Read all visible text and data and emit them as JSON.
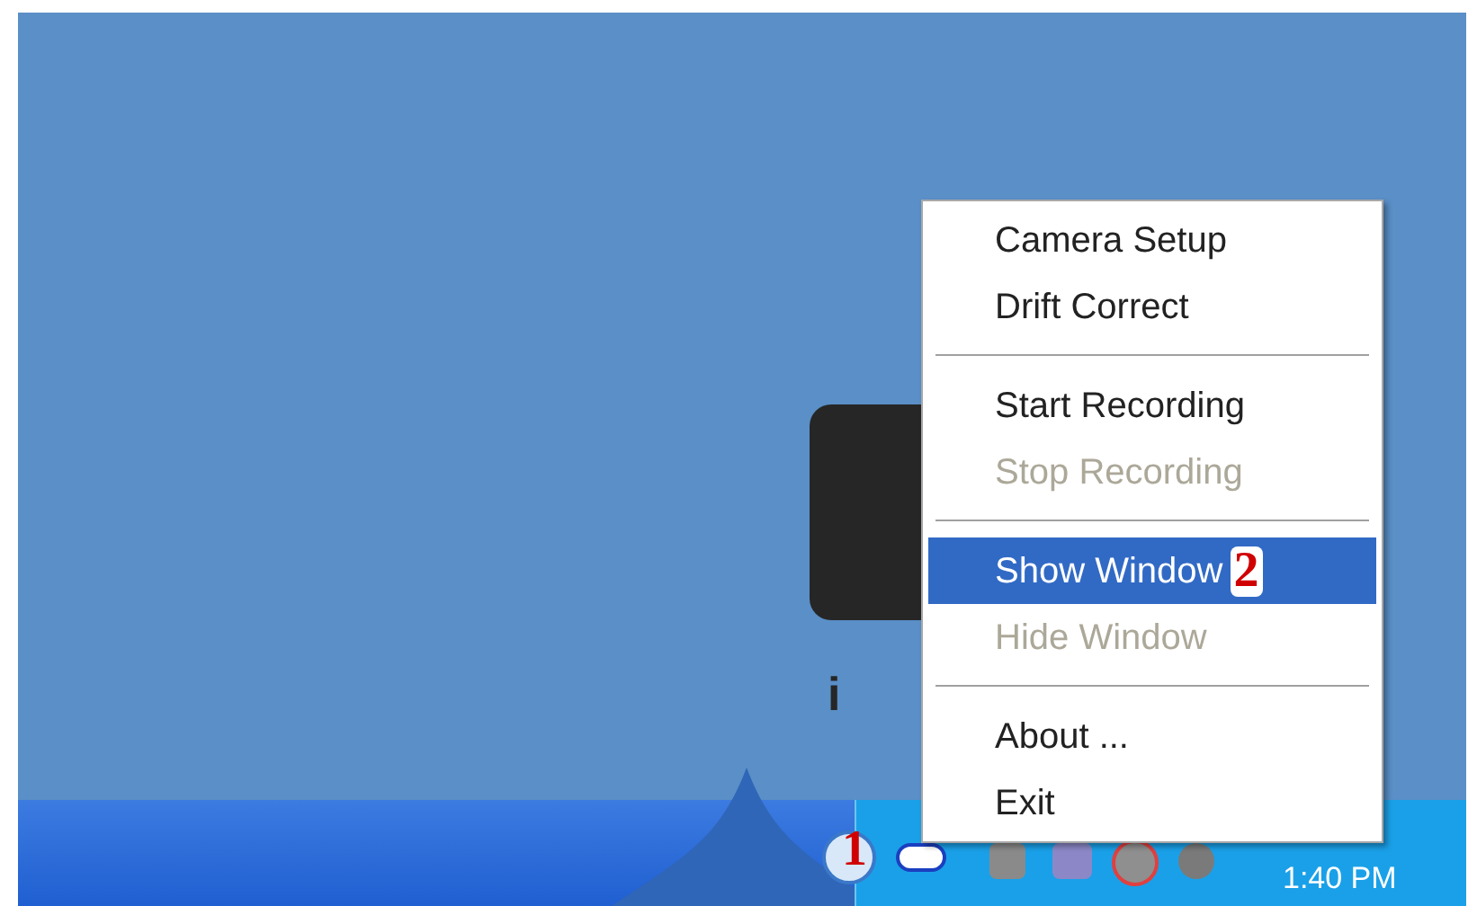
{
  "desktop": {
    "logo_text": "i"
  },
  "taskbar": {
    "clock": "1:40 PM",
    "tray_marker": "1"
  },
  "context_menu": {
    "items": [
      {
        "kind": "item",
        "label": "Camera Setup",
        "disabled": false,
        "selected": false
      },
      {
        "kind": "item",
        "label": "Drift Correct",
        "disabled": false,
        "selected": false
      },
      {
        "kind": "separator"
      },
      {
        "kind": "item",
        "label": "Start Recording",
        "disabled": false,
        "selected": false
      },
      {
        "kind": "item",
        "label": "Stop Recording",
        "disabled": true,
        "selected": false
      },
      {
        "kind": "separator"
      },
      {
        "kind": "item",
        "label": "Show Window",
        "disabled": false,
        "selected": true,
        "marker": "2"
      },
      {
        "kind": "item",
        "label": "Hide Window",
        "disabled": true,
        "selected": false
      },
      {
        "kind": "separator"
      },
      {
        "kind": "item",
        "label": "About ...",
        "disabled": false,
        "selected": false
      },
      {
        "kind": "item",
        "label": "Exit",
        "disabled": false,
        "selected": false
      }
    ]
  }
}
